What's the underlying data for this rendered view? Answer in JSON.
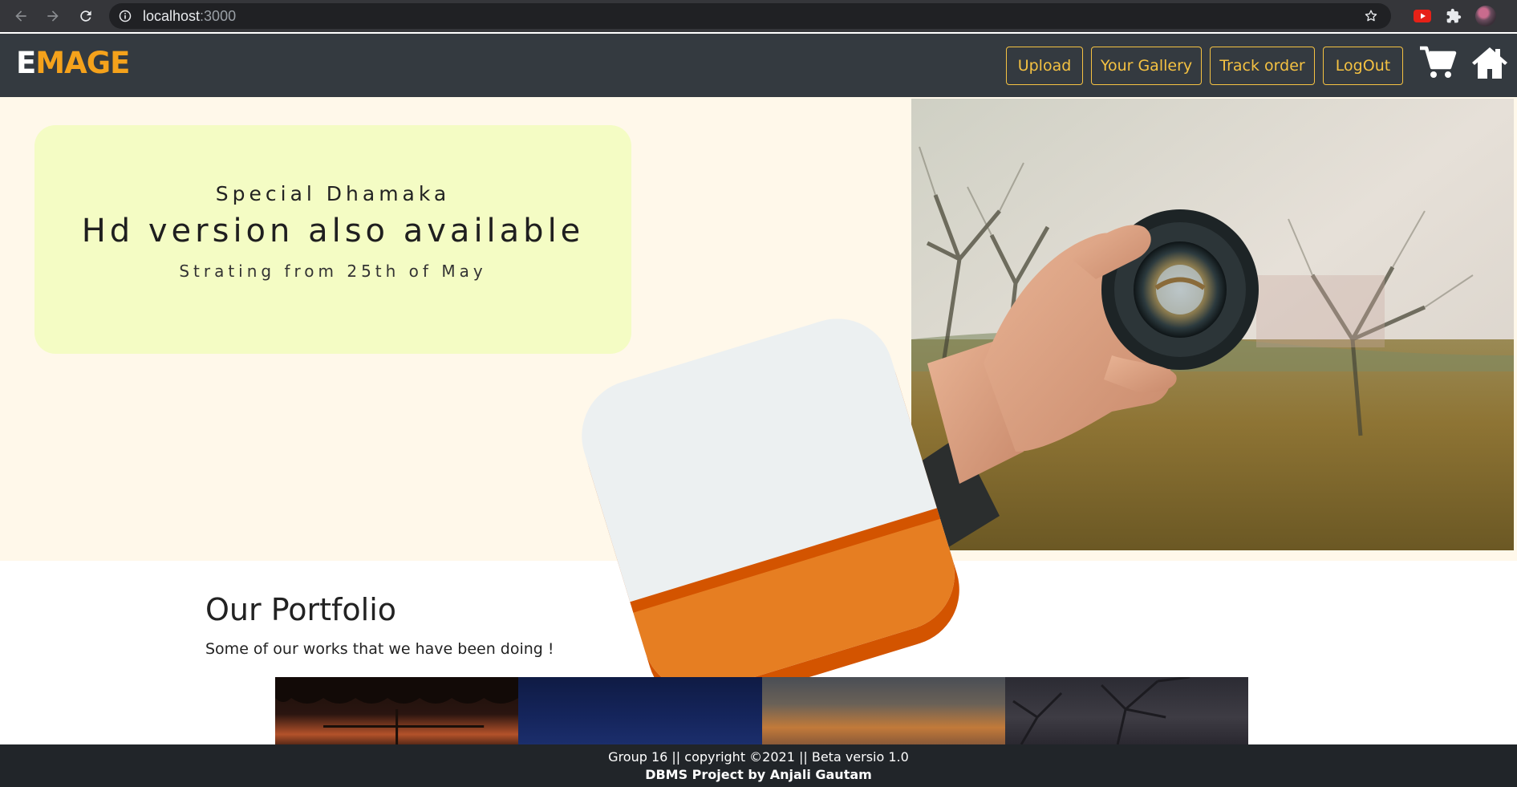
{
  "browser": {
    "url_host": "localhost",
    "url_port": ":3000"
  },
  "navbar": {
    "brand_first": "E",
    "brand_rest": "MAGE",
    "buttons": {
      "upload": "Upload",
      "gallery": "Your Gallery",
      "track": "Track order",
      "logout": "LogOut"
    },
    "icons": [
      "cart-icon",
      "home-icon"
    ],
    "accent_color": "#f5c242",
    "brand_color": "#f5a21b"
  },
  "hero": {
    "kicker": "Special Dhamaka",
    "title": "Hd version also available",
    "subtitle": "Strating from 25th of May",
    "card_color": "#f4fcc4",
    "background_color": "#fff8ea",
    "tile_colors": [
      "#ecf0f1",
      "#e67e22",
      "#d35400"
    ]
  },
  "portfolio": {
    "title": "Our Portfolio",
    "subtitle": "Some of our works that we have been doing !"
  },
  "footer": {
    "line1": "Group 16 || copyright ©2021 || Beta versio 1.0",
    "line2": "DBMS Project by Anjali Gautam"
  }
}
